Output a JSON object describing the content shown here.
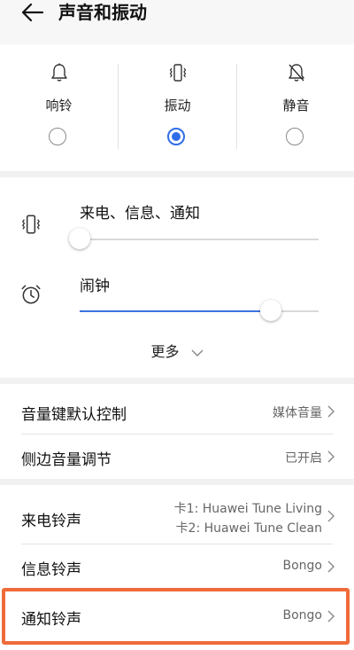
{
  "header": {
    "title": "声音和振动",
    "back_icon": "arrow-left-icon"
  },
  "modes": [
    {
      "label": "响铃",
      "icon": "bell-icon",
      "selected": false
    },
    {
      "label": "振动",
      "icon": "vibrate-icon",
      "selected": true
    },
    {
      "label": "静音",
      "icon": "bell-off-icon",
      "selected": false
    }
  ],
  "volume": {
    "ring": {
      "label": "来电、信息、通知",
      "icon": "vibrate-icon",
      "level": 0.0
    },
    "alarm": {
      "label": "闹钟",
      "icon": "alarm-clock-icon",
      "level": 0.8
    },
    "more_label": "更多"
  },
  "settings": [
    {
      "label": "音量键默认控制",
      "value": "媒体音量"
    },
    {
      "label": "侧边音量调节",
      "value": "已开启"
    }
  ],
  "ringtones": {
    "call": {
      "label": "来电铃声",
      "value_line1": "卡1: Huawei Tune Living",
      "value_line2": "卡2: Huawei Tune Clean"
    },
    "message": {
      "label": "信息铃声",
      "value": "Bongo"
    },
    "notification": {
      "label": "通知铃声",
      "value": "Bongo"
    }
  },
  "colors": {
    "accent": "#2f6ee8",
    "highlight": "#f06b3a"
  }
}
